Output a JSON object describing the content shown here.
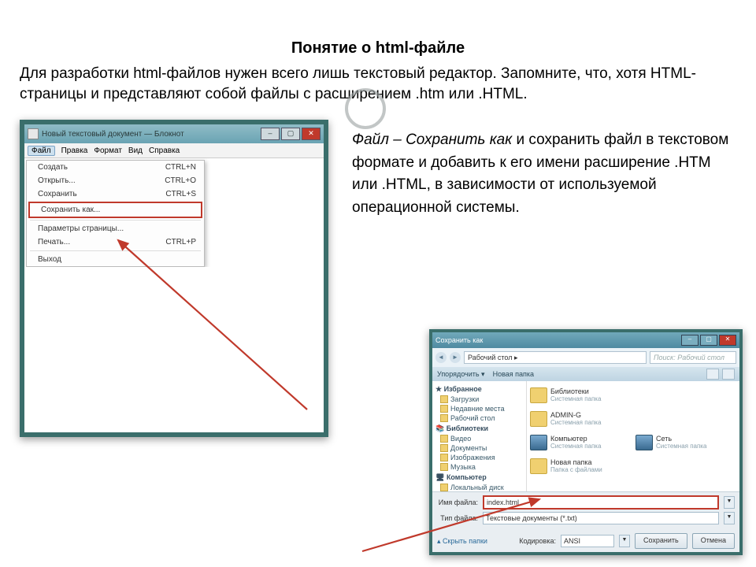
{
  "title": "Понятие о html-файле",
  "intro": "Для разработки html-файлов нужен всего лишь текстовый редактор. Запомните, что, хотя HTML-страницы и представляют собой файлы с расширением .htm или .HTML.",
  "right_text": {
    "italic1": "Файл – Сохранить как",
    "rest": " и сохранить файл в текстовом формате и добавить к его имени расширение .HTM или .HTML, в зависимости от используемой операционной системы."
  },
  "notepad": {
    "title": "Новый текстовый документ — Блокнот",
    "menubar": [
      "Файл",
      "Правка",
      "Формат",
      "Вид",
      "Справка"
    ],
    "menu": [
      {
        "label": "Создать",
        "shortcut": "CTRL+N"
      },
      {
        "label": "Открыть...",
        "shortcut": "CTRL+O"
      },
      {
        "label": "Сохранить",
        "shortcut": "CTRL+S"
      },
      {
        "label": "Сохранить как...",
        "shortcut": ""
      },
      {
        "label": "Параметры страницы...",
        "shortcut": ""
      },
      {
        "label": "Печать...",
        "shortcut": "CTRL+P"
      },
      {
        "label": "Выход",
        "shortcut": ""
      }
    ]
  },
  "savedlg": {
    "title": "Сохранить как",
    "path": "Рабочий стол  ▸",
    "search_placeholder": "Поиск: Рабочий стол",
    "toolbar": [
      "Упорядочить ▾",
      "Новая папка"
    ],
    "sidebar_groups": [
      {
        "name": "Избранное",
        "items": [
          "Загрузки",
          "Недавние места",
          "Рабочий стол"
        ]
      },
      {
        "name": "Библиотеки",
        "items": [
          "Видео",
          "Документы",
          "Изображения",
          "Музыка"
        ]
      },
      {
        "name": "Компьютер",
        "items": [
          "Локальный диск"
        ]
      }
    ],
    "items": [
      {
        "name": "Библиотеки",
        "sub": "Системная папка",
        "icon": "folder"
      },
      {
        "name": "ADMIN-G",
        "sub": "Системная папка",
        "icon": "folder"
      },
      {
        "name": "Компьютер",
        "sub": "Системная папка",
        "icon": "monitor"
      },
      {
        "name": "Сеть",
        "sub": "Системная папка",
        "icon": "monitor"
      },
      {
        "name": "Новая папка",
        "sub": "Папка с файлами",
        "icon": "folder"
      }
    ],
    "filename_label": "Имя файла:",
    "filename_value": "index.html",
    "type_label": "Тип файла:",
    "type_value": "Текстовые документы (*.txt)",
    "hide_folders": "▴ Скрыть папки",
    "encoding_label": "Кодировка:",
    "encoding_value": "ANSI",
    "save": "Сохранить",
    "cancel": "Отмена"
  }
}
